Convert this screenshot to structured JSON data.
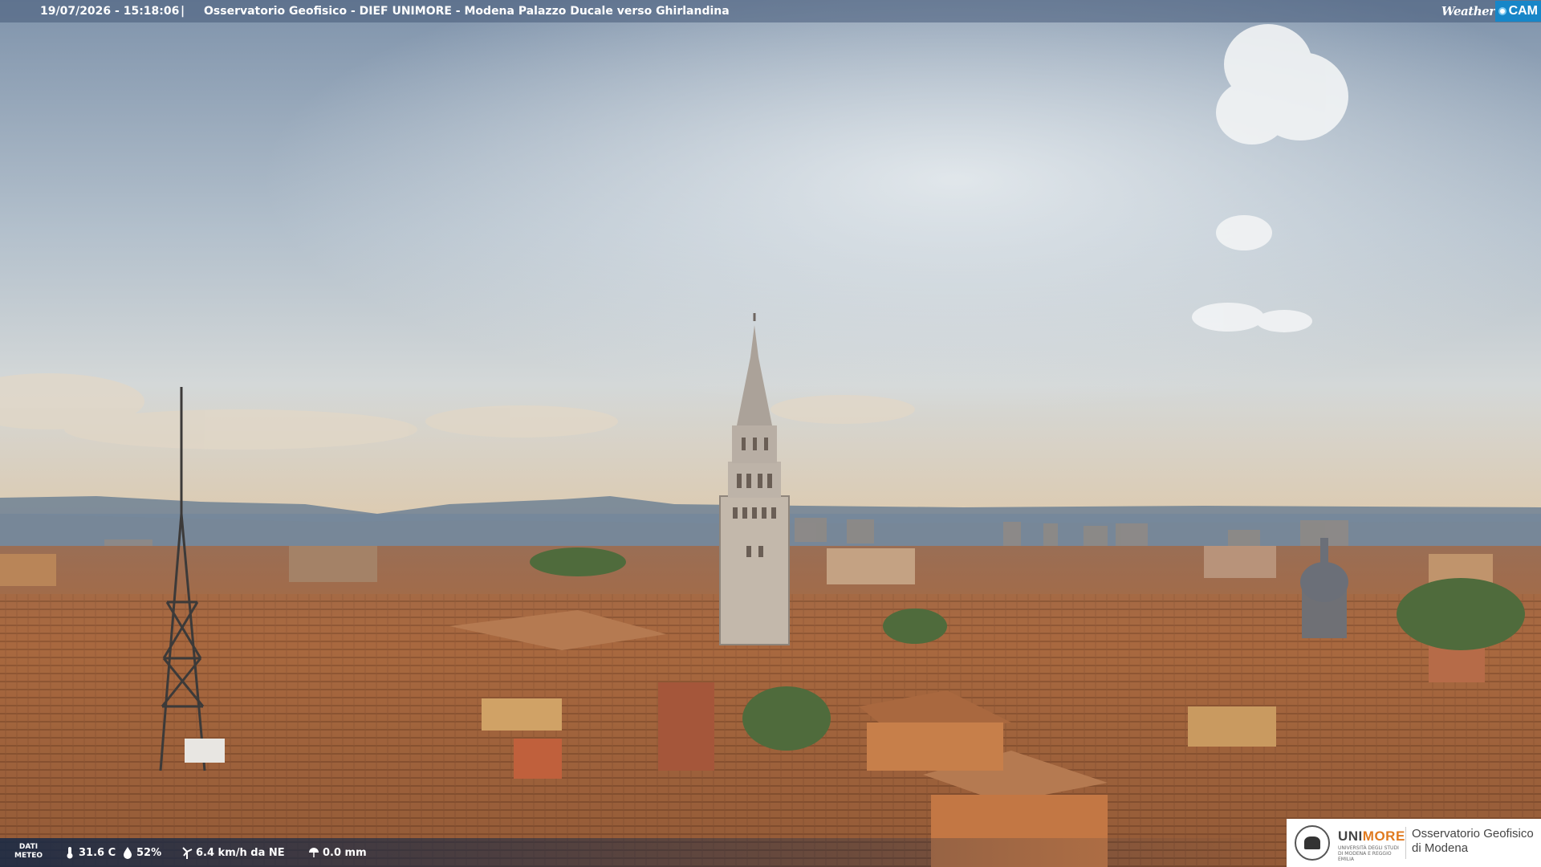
{
  "header": {
    "timestamp": "19/07/2026 - 15:18:06",
    "separator": "|",
    "title": "Osservatorio Geofisico - DIEF UNIMORE - Modena Palazzo Ducale verso Ghirlandina"
  },
  "brand": {
    "weather": "Weather",
    "cam": "CAM"
  },
  "weather_bar": {
    "label_line1": "DATI",
    "label_line2": "METEO",
    "temperature": "31.6 C",
    "humidity": "52%",
    "wind": "6.4 km/h da NE",
    "rain": "0.0 mm"
  },
  "logo": {
    "uni_prefix": "UNI",
    "uni_suffix": "MORE",
    "uni_sub": "UNIVERSITÀ DEGLI STUDI DI MODENA E REGGIO EMILIA",
    "obs_line1": "Osservatorio Geofisico",
    "obs_line2": "di Modena"
  },
  "colors": {
    "sky_top": "#8fa2b8",
    "sky_haze": "#d6dde3",
    "roof": "#a86a44",
    "accent_cam": "#1786c8",
    "accent_unimore": "#e07a1f"
  }
}
